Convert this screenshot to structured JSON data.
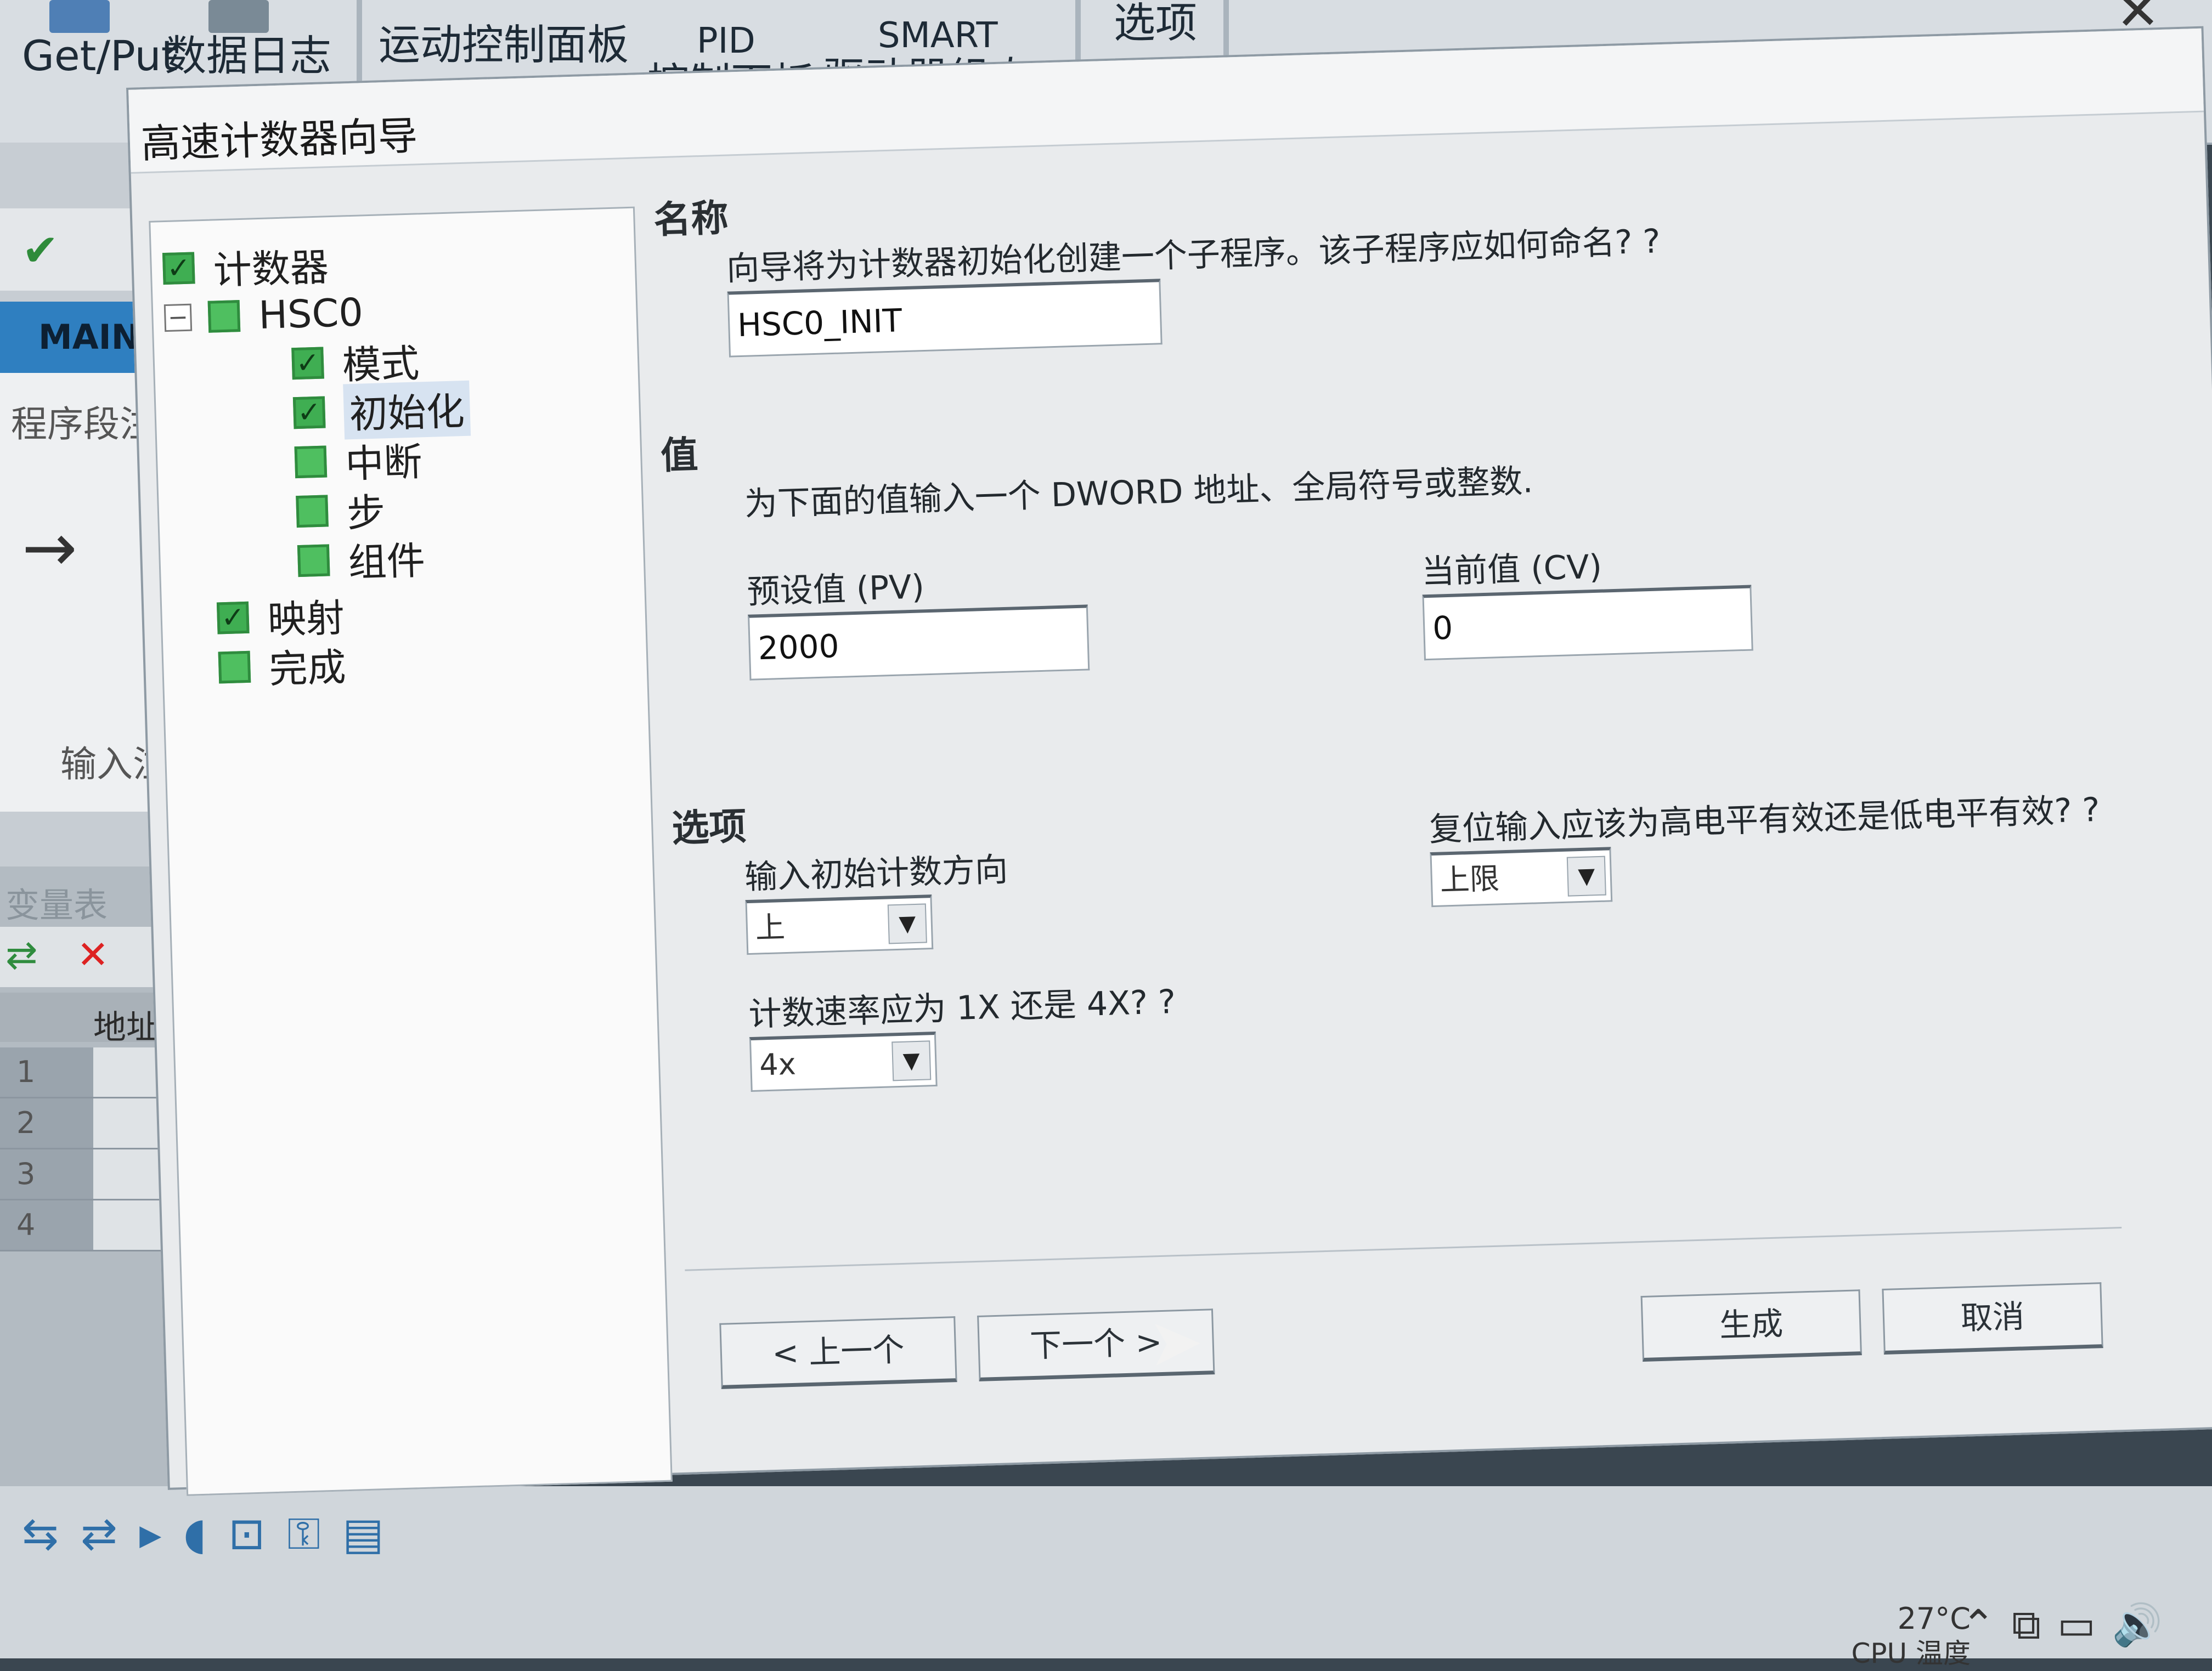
{
  "ribbon": {
    "items": [
      "Get/Put",
      "数据日志",
      "运动控制面板",
      "PID",
      "控制面板",
      "SMART",
      "驱动器组态",
      "选项"
    ]
  },
  "left_panel": {
    "main_tab": "MAIN",
    "program_comment": "程序段注",
    "input_comment": "输入注释",
    "symbol_table_title": "变量表",
    "address_header": "地址",
    "rows": [
      "1",
      "2",
      "3",
      "4"
    ]
  },
  "dialog": {
    "title": "高速计数器向导",
    "close_glyph": "✕",
    "tree": [
      {
        "label": "计数器",
        "level": 0,
        "checked": true
      },
      {
        "label": "HSC0",
        "level": 1,
        "checked": false,
        "expand": "日"
      },
      {
        "label": "模式",
        "level": 2,
        "checked": true
      },
      {
        "label": "初始化",
        "level": 2,
        "checked": true,
        "selected": true
      },
      {
        "label": "中断",
        "level": 2,
        "checked": false
      },
      {
        "label": "步",
        "level": 2,
        "checked": false
      },
      {
        "label": "组件",
        "level": 2,
        "checked": false
      },
      {
        "label": "映射",
        "level": 0,
        "checked": true
      },
      {
        "label": "完成",
        "level": 0,
        "checked": false
      }
    ],
    "name_section": {
      "heading": "名称",
      "question": "向导将为计数器初始化创建一个子程序。该子程序应如何命名? ?",
      "value": "HSC0_INIT"
    },
    "value_section": {
      "heading": "值",
      "description": "为下面的值输入一个 DWORD 地址、全局符号或整数.",
      "preset_label": "预设值 (PV)",
      "preset_value": "2000",
      "current_label": "当前值 (CV)",
      "current_value": "0"
    },
    "options_section": {
      "heading": "选项",
      "direction_label": "输入初始计数方向",
      "direction_value": "上",
      "rate_label": "计数速率应为 1X 还是 4X? ?",
      "rate_value": "4x",
      "reset_label": "复位输入应该为高电平有效还是低电平有效? ?",
      "reset_value": "上限"
    },
    "buttons": {
      "prev": "< 上一个",
      "next": "下一个 >",
      "generate": "生成",
      "cancel": "取消"
    }
  },
  "status": {
    "temperature": "27°C",
    "temperature_label": "CPU 温度"
  }
}
